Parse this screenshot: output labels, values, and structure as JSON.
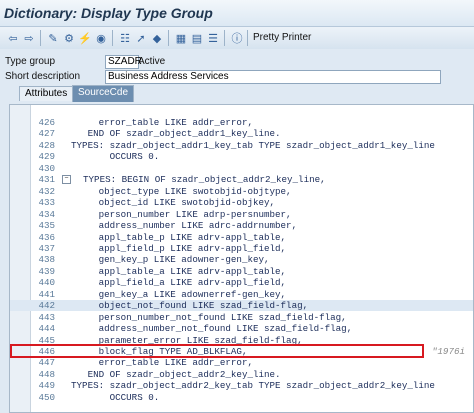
{
  "window": {
    "title": "Dictionary: Display Type Group"
  },
  "toolbar": {
    "icons": [
      "back-arrow-icon",
      "forward-arrow-icon",
      "display-change-icon",
      "other-object-icon",
      "activate-icon",
      "where-used-icon",
      "display-object-list-icon",
      "navigate-icon",
      "hierarchy-icon",
      "check-icon",
      "table-icon",
      "info-icon"
    ],
    "pretty_printer": "Pretty Printer"
  },
  "form": {
    "type_group_label": "Type group",
    "type_group_value": "SZADR",
    "type_group_status": "Active",
    "short_desc_label": "Short description",
    "short_desc_value": "Business Address Services"
  },
  "tabs": [
    {
      "label": "Attributes"
    },
    {
      "label": "SourceCde"
    }
  ],
  "code_lines": [
    {
      "num": "426",
      "text": "       error_table LIKE addr_error,"
    },
    {
      "num": "427",
      "text": "     END OF szadr_object_addr1_key_line."
    },
    {
      "num": "428",
      "text": "  TYPES: szadr_object_addr1_key_tab TYPE szadr_object_addr1_key_line"
    },
    {
      "num": "429",
      "text": "         OCCURS 0."
    },
    {
      "num": "430",
      "text": ""
    },
    {
      "num": "431",
      "text": "  TYPES: BEGIN OF szadr_object_addr2_key_line,"
    },
    {
      "num": "432",
      "text": "       object_type LIKE swotobjid-objtype,"
    },
    {
      "num": "433",
      "text": "       object_id LIKE swotobjid-objkey,"
    },
    {
      "num": "434",
      "text": "       person_number LIKE adrp-persnumber,"
    },
    {
      "num": "435",
      "text": "       address_number LIKE adrc-addrnumber,"
    },
    {
      "num": "436",
      "text": "       appl_table_p LIKE adrv-appl_table,"
    },
    {
      "num": "437",
      "text": "       appl_field_p LIKE adrv-appl_field,"
    },
    {
      "num": "438",
      "text": "       gen_key_p LIKE adowner-gen_key,"
    },
    {
      "num": "439",
      "text": "       appl_table_a LIKE adrv-appl_table,"
    },
    {
      "num": "440",
      "text": "       appl_field_a LIKE adrv-appl_field,"
    },
    {
      "num": "441",
      "text": "       gen_key_a LIKE adownerref-gen_key,"
    },
    {
      "num": "442",
      "text": "       object_not_found LIKE szad_field-flag,"
    },
    {
      "num": "443",
      "text": "       person_number_not_found LIKE szad_field-flag,"
    },
    {
      "num": "444",
      "text": "       address_number_not_found LIKE szad_field-flag,"
    },
    {
      "num": "445",
      "text": "       parameter_error LIKE szad_field-flag,"
    },
    {
      "num": "446",
      "text": "       block_flag TYPE AD_BLKFLAG,",
      "comment": "\"1976i"
    },
    {
      "num": "447",
      "text": "       error_table LIKE addr_error,"
    },
    {
      "num": "448",
      "text": "     END OF szadr_object_addr2_key_line."
    },
    {
      "num": "449",
      "text": "  TYPES: szadr_object_addr2_key_tab TYPE szadr_object_addr2_key_line"
    },
    {
      "num": "450",
      "text": "         OCCURS 0."
    }
  ]
}
